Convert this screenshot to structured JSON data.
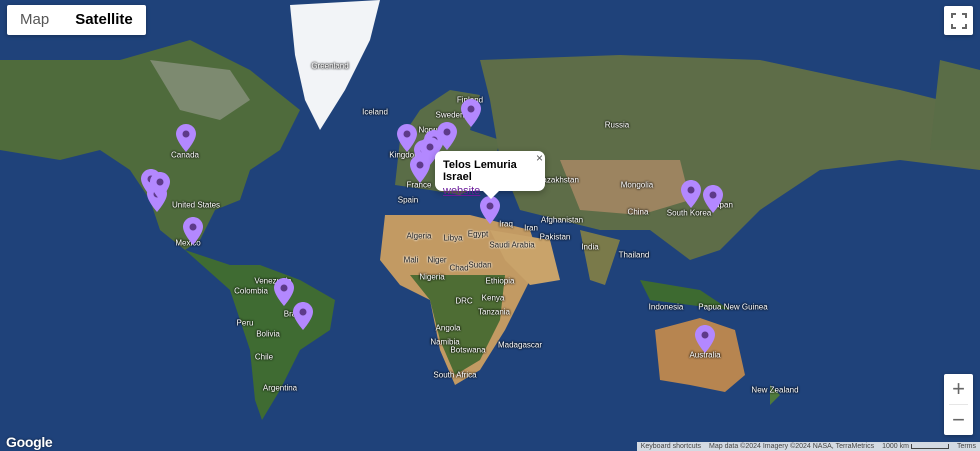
{
  "map_type": {
    "map_label": "Map",
    "satellite_label": "Satellite",
    "active": "Satellite"
  },
  "controls": {
    "fullscreen_icon": "fullscreen-icon",
    "zoom_in": "+",
    "zoom_out": "−"
  },
  "popup": {
    "title": "Telos Lemuria Israel",
    "link": "website",
    "close": "×"
  },
  "branding": {
    "logo": "Google"
  },
  "attribution": {
    "shortcuts": "Keyboard shortcuts",
    "data": "Map data ©2024 Imagery ©2024 NASA, TerraMetrics",
    "scale": "1000 km",
    "terms": "Terms"
  },
  "labels": {
    "greenland": "Greenland",
    "iceland": "Iceland",
    "finland": "Finland",
    "sweden": "Sweden",
    "norway": "Norway",
    "russia": "Russia",
    "canada": "Canada",
    "united_states": "United States",
    "mexico": "Mexico",
    "venezuela": "Venezuela",
    "colombia": "Colombia",
    "peru": "Peru",
    "brazil": "Bra",
    "bolivia": "Bolivia",
    "chile": "Chile",
    "argentina": "Argentina",
    "kingdom": "Kingdom",
    "france": "France",
    "spain": "Spain",
    "algeria": "Algeria",
    "libya": "Libya",
    "egypt": "Egypt",
    "mali": "Mali",
    "niger": "Niger",
    "chad": "Chad",
    "nigeria": "Nigeria",
    "sudan": "Sudan",
    "ethiopia": "Ethiopia",
    "drc": "DRC",
    "kenya": "Kenya",
    "tanzania": "Tanzania",
    "angola": "Angola",
    "namibia": "Namibia",
    "botswana": "Botswana",
    "south_africa": "South Africa",
    "madagascar": "Madagascar",
    "saudi_arabia": "Saudi Arabia",
    "iraq": "Iraq",
    "iran": "Iran",
    "afghanistan": "Afghanistan",
    "pakistan": "Pakistan",
    "india": "India",
    "kazakhstan": "Kazakhstan",
    "mongolia": "Mongolia",
    "china": "China",
    "south_korea": "South Korea",
    "japan": "Japan",
    "thailand": "Thailand",
    "indonesia": "Indonesia",
    "papua_new_guinea": "Papua New Guinea",
    "australia": "Australia",
    "new_zealand": "New Zealand"
  },
  "marker_color": "#b388ff",
  "marker_count": 18
}
